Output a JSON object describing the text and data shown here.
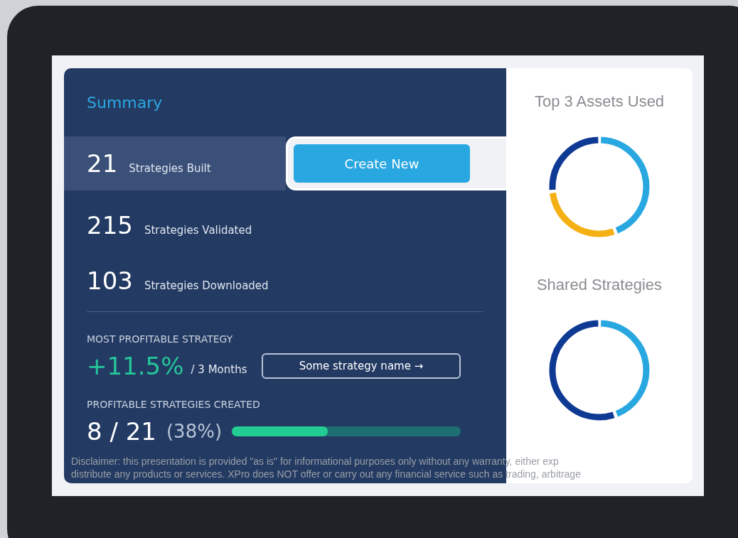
{
  "summary": {
    "title": "Summary",
    "primary_stat": {
      "value": "21",
      "label": "Strategies Built"
    },
    "action_button": "Create New",
    "stats": [
      {
        "value": "215",
        "label": "Strategies Validated"
      },
      {
        "value": "103",
        "label": "Strategies Downloaded"
      }
    ],
    "most_profitable": {
      "heading": "MOST PROFITABLE STRATEGY",
      "gain": "+11.5%",
      "period": "/ 3 Months",
      "link": "Some strategy name →"
    },
    "profitable_created": {
      "heading": "PROFITABLE STRATEGIES CREATED",
      "count": "8 / 21",
      "percent": "(38%)",
      "level": 0.42
    }
  },
  "side": {
    "charts": [
      {
        "title": "Top 3 Assets Used"
      },
      {
        "title": "Shared Strategies"
      }
    ]
  },
  "disclaimer": [
    "Disclaimer: this presentation is provided \"as is\" for informational purposes only without any warranty, either exp",
    "distribute any products or services. XPro does NOT offer or carry out any financial service such as trading, arbitrage"
  ]
}
